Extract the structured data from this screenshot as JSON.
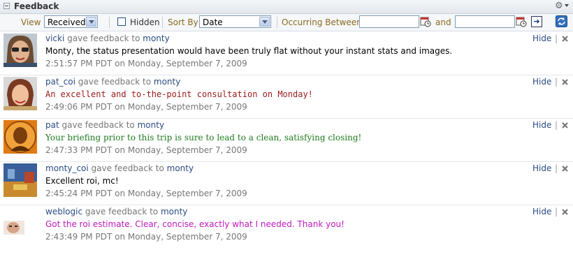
{
  "panel": {
    "title": "Feedback"
  },
  "toolbar": {
    "view_label": "View",
    "view_value": "Received",
    "hidden_label": "Hidden",
    "sort_label": "Sort By",
    "sort_value": "Date",
    "occurring_label": "Occurring Between",
    "and_label": "and",
    "from_value": "",
    "to_value": ""
  },
  "feedback": [
    {
      "from": "vicki",
      "action": "gave feedback to",
      "to": "monty",
      "message": "Monty, the status presentation would have been truly flat without your instant stats and images.",
      "time": "2:51:57 PM PDT on Monday, September 7, 2009",
      "hide": "Hide",
      "style": "m-sans"
    },
    {
      "from": "pat_coi",
      "action": "gave feedback to",
      "to": "monty",
      "message": "An excellent and to-the-point consultation on Monday!",
      "time": "2:49:06 PM PDT on Monday, September 7, 2009",
      "hide": "Hide",
      "style": "m-mono"
    },
    {
      "from": "pat",
      "action": "gave feedback to",
      "to": "monty",
      "message": "Your briefing prior to this trip is sure to lead to a clean, satisfying closing!",
      "time": "2:47:33 PM PDT on Monday, September 7, 2009",
      "hide": "Hide",
      "style": "m-green"
    },
    {
      "from": "monty_coi",
      "action": "gave feedback to",
      "to": "monty",
      "message": "Excellent roi, mc!",
      "time": "2:45:24 PM PDT on Monday, September 7, 2009",
      "hide": "Hide",
      "style": "m-black"
    },
    {
      "from": "weblogic",
      "action": "gave feedback to",
      "to": "monty",
      "message": "Got the roi estimate. Clear, concise, exactly what I needed. Thank you!",
      "time": "2:43:49 PM PDT on Monday, September 7, 2009",
      "hide": "Hide",
      "style": "m-purple"
    }
  ],
  "colors": {
    "link": "#2a4b83",
    "label": "#8a6a1e"
  }
}
